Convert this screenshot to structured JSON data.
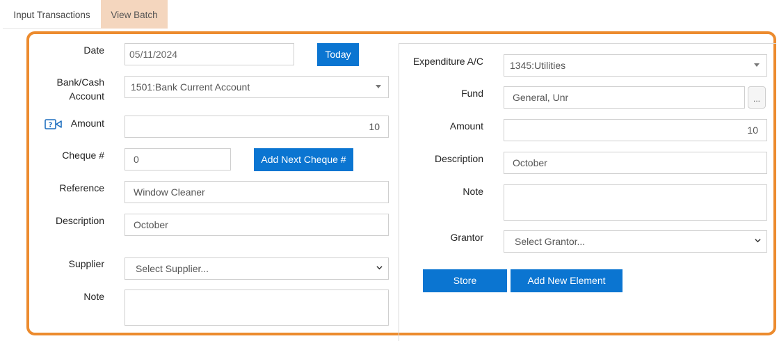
{
  "tabs": [
    {
      "label": "Input Transactions",
      "active": true
    },
    {
      "label": "View Batch",
      "active": false
    }
  ],
  "left": {
    "date": {
      "label": "Date",
      "value": "05/11/2024",
      "button": "Today"
    },
    "bank": {
      "label_line1": "Bank/Cash",
      "label_line2": "Account",
      "value": "1501:Bank Current Account"
    },
    "amount": {
      "label": "Amount",
      "value": "10",
      "help_icon": "video-help-icon"
    },
    "cheque": {
      "label": "Cheque #",
      "value": "0",
      "button": "Add Next Cheque #"
    },
    "reference": {
      "label": "Reference",
      "value": "Window Cleaner"
    },
    "description": {
      "label": "Description",
      "value": "October"
    },
    "supplier": {
      "label": "Supplier",
      "placeholder": "Select Supplier..."
    },
    "note": {
      "label": "Note",
      "value": ""
    }
  },
  "right": {
    "expenditure": {
      "label": "Expenditure A/C",
      "value": "1345:Utilities"
    },
    "fund": {
      "label": "Fund",
      "value": "General, Unr",
      "button": "..."
    },
    "amount": {
      "label": "Amount",
      "value": "10"
    },
    "description": {
      "label": "Description",
      "value": "October"
    },
    "note": {
      "label": "Note",
      "value": ""
    },
    "grantor": {
      "label": "Grantor",
      "placeholder": "Select Grantor..."
    },
    "store_button": "Store",
    "add_element_button": "Add New Element"
  },
  "colors": {
    "accent": "#0b75d1",
    "highlight": "#ec8b2e",
    "active_tab_bg": "#f4d6be"
  }
}
